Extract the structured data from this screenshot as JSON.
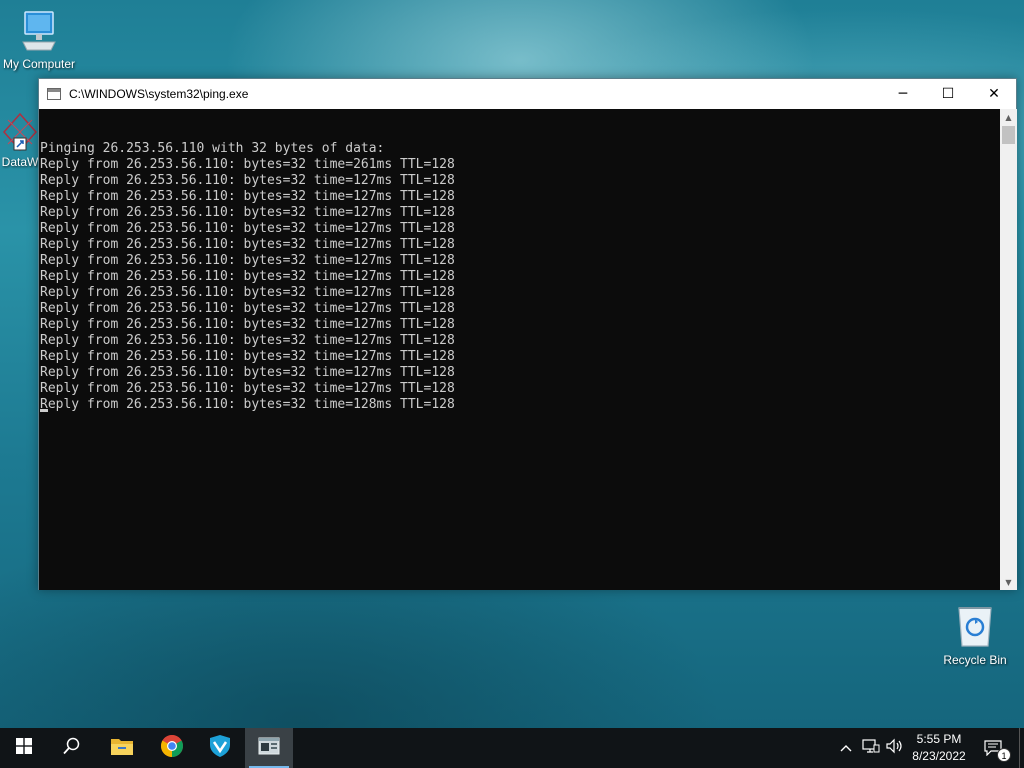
{
  "desktop": {
    "icons": {
      "my_computer": "My Computer",
      "dataw": "DataW",
      "recycle_bin": "Recycle Bin"
    }
  },
  "window": {
    "title": "C:\\WINDOWS\\system32\\ping.exe",
    "controls": {
      "minimize": "─",
      "maximize": "☐",
      "close": "✕"
    },
    "console_lines": [
      "",
      "Pinging 26.253.56.110 with 32 bytes of data:",
      "Reply from 26.253.56.110: bytes=32 time=261ms TTL=128",
      "Reply from 26.253.56.110: bytes=32 time=127ms TTL=128",
      "Reply from 26.253.56.110: bytes=32 time=127ms TTL=128",
      "Reply from 26.253.56.110: bytes=32 time=127ms TTL=128",
      "Reply from 26.253.56.110: bytes=32 time=127ms TTL=128",
      "Reply from 26.253.56.110: bytes=32 time=127ms TTL=128",
      "Reply from 26.253.56.110: bytes=32 time=127ms TTL=128",
      "Reply from 26.253.56.110: bytes=32 time=127ms TTL=128",
      "Reply from 26.253.56.110: bytes=32 time=127ms TTL=128",
      "Reply from 26.253.56.110: bytes=32 time=127ms TTL=128",
      "Reply from 26.253.56.110: bytes=32 time=127ms TTL=128",
      "Reply from 26.253.56.110: bytes=32 time=127ms TTL=128",
      "Reply from 26.253.56.110: bytes=32 time=127ms TTL=128",
      "Reply from 26.253.56.110: bytes=32 time=127ms TTL=128",
      "Reply from 26.253.56.110: bytes=32 time=127ms TTL=128",
      "Reply from 26.253.56.110: bytes=32 time=128ms TTL=128"
    ]
  },
  "taskbar": {
    "apps": [
      "start-icon",
      "search-icon",
      "file-explorer-icon",
      "chrome-icon",
      "vpn-icon",
      "console-icon"
    ],
    "clock": {
      "time": "5:55 PM",
      "date": "8/23/2022"
    },
    "notification_count": "1"
  },
  "colors": {
    "console_bg": "#0c0c0c",
    "console_fg": "#cccccc",
    "taskbar_bg": "#101417",
    "accent": "#76b9ed"
  }
}
